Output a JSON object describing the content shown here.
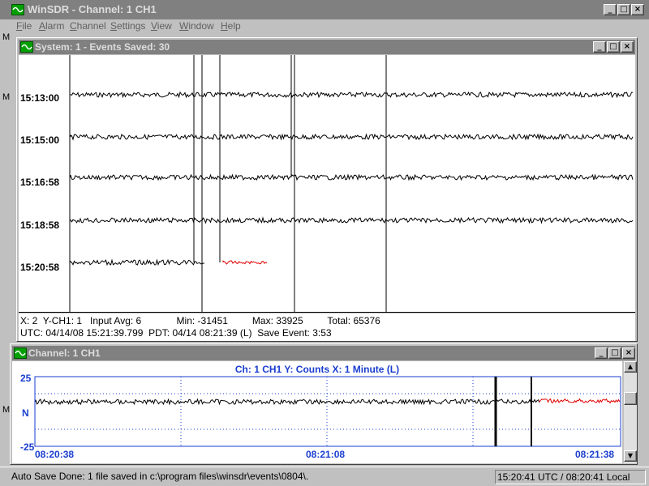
{
  "app": {
    "title": "WinSDR - Channel: 1 CH1",
    "menu": [
      {
        "label": "File",
        "key": "F",
        "rest": "ile"
      },
      {
        "label": "Alarm",
        "key": "A",
        "rest": "larm"
      },
      {
        "label": "Channel",
        "key": "C",
        "rest": "hannel"
      },
      {
        "label": "Settings",
        "key": "S",
        "rest": "ettings"
      },
      {
        "label": "View",
        "key": "V",
        "rest": "iew"
      },
      {
        "label": "Window",
        "key": "W",
        "rest": "indow"
      },
      {
        "label": "Help",
        "key": "H",
        "rest": "elp"
      }
    ],
    "side_letters": [
      "M",
      "M",
      "M"
    ]
  },
  "system_window": {
    "title": "System: 1 - Events Saved: 30",
    "time_labels": [
      "15:13:00",
      "15:15:00",
      "15:16:58",
      "15:18:58",
      "15:20:58"
    ],
    "info_line1": "X: 2  Y-CH1: 1   Input Avg: 6             Min: -31451         Max: 33925         Total: 65376",
    "info_line2": "UTC: 04/14/08 15:21:39.799  PDT: 04/14 08:21:39 (L)  Save Event: 3:53",
    "trace_color": "#000000",
    "highlight_color": "#e00000"
  },
  "channel_window": {
    "title": "Channel: 1 CH1",
    "header": "Ch: 1 CH1  Y: Counts  X: 1 Minute (L)",
    "y_top": "25",
    "y_mid": "N",
    "y_bottom": "-25",
    "x_labels": [
      "08:20:38",
      "08:21:08",
      "08:21:38"
    ],
    "axis_color": "#1a3ed0"
  },
  "status": {
    "left": "Auto Save Done: 1 file saved in c:\\program files\\winsdr\\events\\0804\\.",
    "right": "15:20:41 UTC / 08:20:41 Local"
  }
}
